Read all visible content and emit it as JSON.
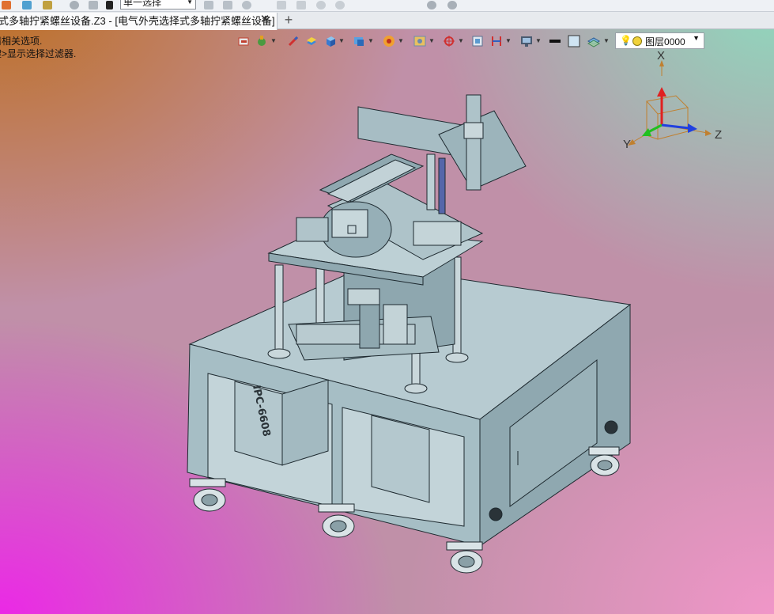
{
  "top_toolbar": {
    "select_filter_value": "单一选择",
    "icons": [
      "app-icon",
      "layer-icon",
      "grid-icon",
      "undo-icon",
      "filter-icon",
      "box-select-icon"
    ]
  },
  "tabs": [
    {
      "label": "式多轴拧紧螺丝设备.Z3 - [电气外壳选择式多轴拧紧螺丝设备]",
      "active": true
    }
  ],
  "tab_close_glyph": "✕",
  "new_tab_glyph": "+",
  "prompt": {
    "line1": "请相关选项.",
    "line2": "键>显示选择过滤器."
  },
  "view_toolbar": {
    "icons": [
      "shape-icon",
      "paint-icon",
      "pen-icon",
      "solid-icon",
      "cube-icon",
      "view-cube-icon",
      "wheel-icon",
      "render-icon",
      "datum-icon",
      "frame-icon",
      "measure-icon",
      "monitor-icon",
      "line-color-icon",
      "fill-color-icon",
      "layers-icon"
    ],
    "layer_label": "图层0000"
  },
  "axis": {
    "x": "X",
    "y": "Y",
    "z": "Z",
    "colors": {
      "x": "#e02020",
      "y": "#20c020",
      "z": "#2040e0",
      "box": "#c08030"
    }
  },
  "model": {
    "cabinet_label": "IPC-6608",
    "colors": {
      "body": "#9fb8c0",
      "body_dark": "#7f9aa3",
      "edge": "#1e2a30",
      "top": "#bcd0d6"
    }
  }
}
